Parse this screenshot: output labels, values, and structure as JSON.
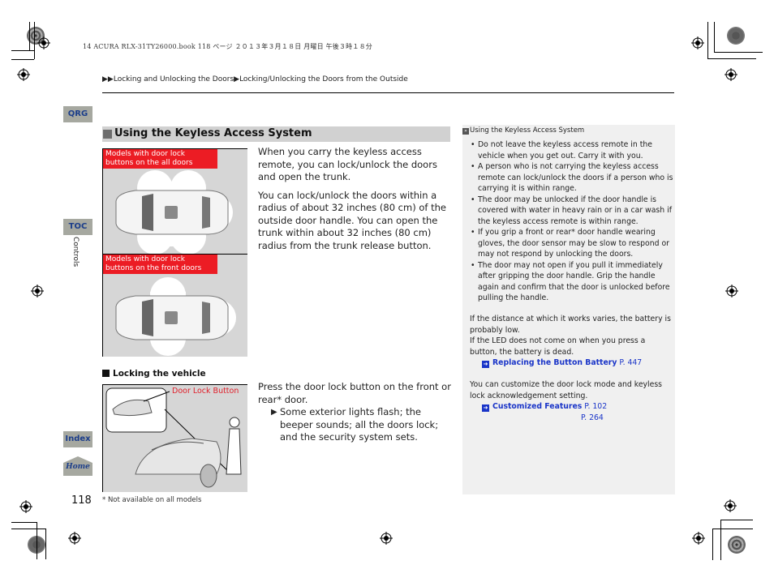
{
  "print_header": "14 ACURA RLX-31TY26000.book  118 ページ  ２０１３年３月１８日  月曜日  午後３時１８分",
  "breadcrumb": {
    "prefix_icon": "double-triangle-right",
    "items": [
      "Locking and Unlocking the Doors",
      "Locking/Unlocking the Doors from the Outside"
    ]
  },
  "side_nav": {
    "qrg": "QRG",
    "toc": "TOC",
    "section": "Controls",
    "index": "Index",
    "home": "Home"
  },
  "section": {
    "title": "Using the Keyless Access System",
    "figure1_label": "Models with door lock buttons on the all doors",
    "figure2_label": "Models with door lock buttons on the front doors",
    "paragraphs": [
      "When you carry the keyless access remote, you can lock/unlock the doors and open the trunk.",
      "You can lock/unlock the doors within a radius of about 32 inches (80 cm) of the outside door handle. You can open the trunk within about 32 inches (80 cm) radius from the trunk release button."
    ]
  },
  "locking": {
    "title": "Locking the vehicle",
    "callout": "Door Lock Button",
    "text": "Press the door lock button on the front or rear* door.",
    "result": "Some exterior lights flash; the beeper sounds; all the doors lock; and the security system sets."
  },
  "sidebar": {
    "header": "Using the Keyless Access System",
    "bullets": [
      "Do not leave the keyless access remote in the vehicle when you get out. Carry it with you.",
      "A person who is not carrying the keyless access remote can lock/unlock the doors if a person who is carrying it is within range.",
      "The door may be unlocked if the door handle is covered with water in heavy rain or in a car wash if the keyless access remote is within range.",
      "If you grip a front or rear* door handle wearing gloves, the door sensor may be slow to respond or may not respond by unlocking the doors.",
      "The door may not open if you pull it immediately after gripping the door handle. Grip the handle again and confirm that the door is unlocked before pulling the handle."
    ],
    "battery_note": "If the distance at which it works varies, the battery is probably low.",
    "led_note": "If the LED does not come on when you press a button, the battery is dead.",
    "xref1": {
      "label": "Replacing the Button Battery",
      "page": "P. 447"
    },
    "customize_note": "You can customize the door lock mode and keyless lock acknowledgement setting.",
    "xref2": {
      "label": "Customized Features",
      "page": "P. 102",
      "page2": "P. 264"
    }
  },
  "page_number": "118",
  "footnote": "* Not available on all models"
}
